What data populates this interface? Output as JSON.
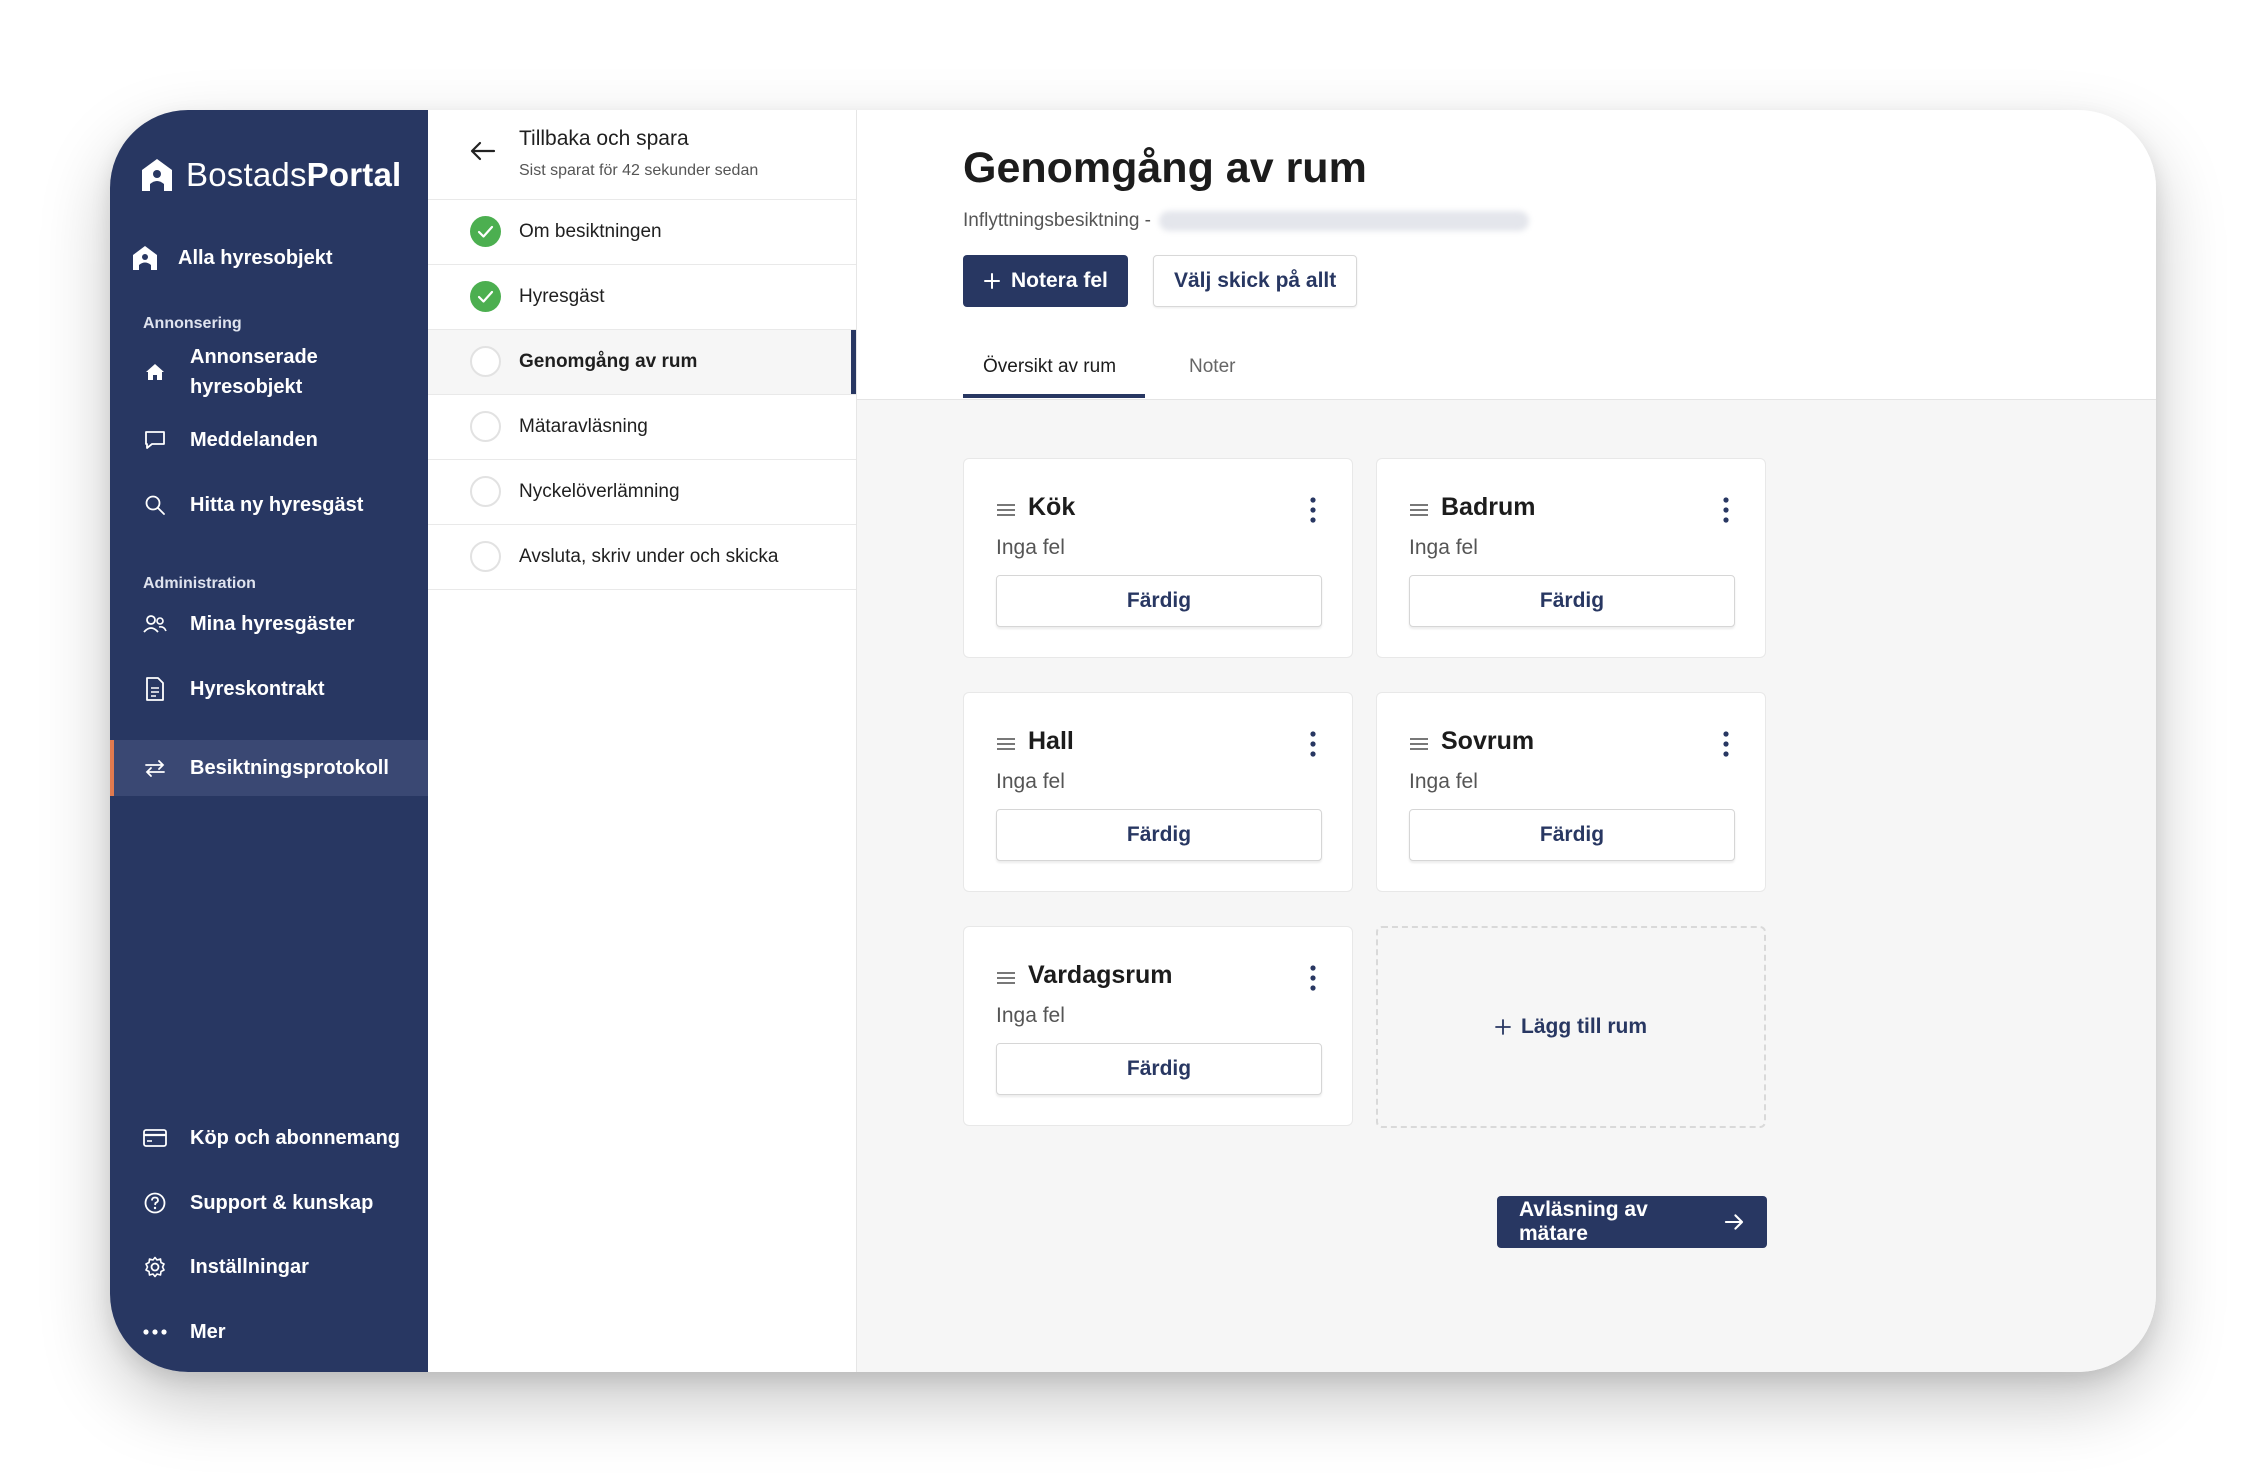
{
  "brand": {
    "name_light": "Bostads",
    "name_bold": "Portal"
  },
  "sidebar": {
    "all_objects": "Alla hyresobjekt",
    "section_ads": "Annonsering",
    "ads_items": [
      "Annonserade hyresobjekt",
      "Meddelanden",
      "Hitta ny hyresgäst"
    ],
    "section_admin": "Administration",
    "admin_items": [
      "Mina hyresgäster",
      "Hyreskontrakt",
      "Besiktningsprotokoll"
    ],
    "bottom_items": [
      "Köp och abonnemang",
      "Support & kunskap",
      "Inställningar",
      "Mer"
    ]
  },
  "steps_panel": {
    "back_label": "Tillbaka och spara",
    "saved_text": "Sist sparat för 42 sekunder sedan",
    "steps": [
      {
        "label": "Om besiktningen",
        "state": "done"
      },
      {
        "label": "Hyresgäst",
        "state": "done"
      },
      {
        "label": "Genomgång av rum",
        "state": "current"
      },
      {
        "label": "Mätaravläsning",
        "state": "todo"
      },
      {
        "label": "Nyckelöverlämning",
        "state": "todo"
      },
      {
        "label": "Avsluta, skriv under och skicka",
        "state": "todo"
      }
    ]
  },
  "main": {
    "title": "Genomgång av rum",
    "subtitle": "Inflyttningsbesiktning -",
    "report_button": "Notera fel",
    "condition_button": "Välj skick på allt",
    "tabs": [
      "Översikt av rum",
      "Noter"
    ],
    "rooms": [
      {
        "name": "Kök",
        "status": "Inga fel",
        "action": "Färdig"
      },
      {
        "name": "Badrum",
        "status": "Inga fel",
        "action": "Färdig"
      },
      {
        "name": "Hall",
        "status": "Inga fel",
        "action": "Färdig"
      },
      {
        "name": "Sovrum",
        "status": "Inga fel",
        "action": "Färdig"
      },
      {
        "name": "Vardagsrum",
        "status": "Inga fel",
        "action": "Färdig"
      }
    ],
    "add_room": "Lägg till rum",
    "next_button": "Avläsning av mätare"
  },
  "colors": {
    "navy": "#283762",
    "success": "#4caf50",
    "accent": "#e07a4f"
  }
}
